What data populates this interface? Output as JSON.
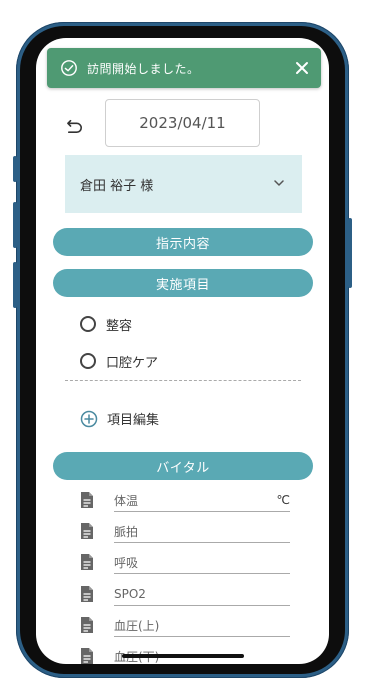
{
  "toast": {
    "message": "訪問開始しました。",
    "color": "#4f9a73"
  },
  "header": {
    "date_value": "2023/04/11"
  },
  "patient": {
    "name": "倉田 裕子 様"
  },
  "sections": {
    "instructions": "指示内容",
    "items": "実施項目",
    "vitals": "バイタル"
  },
  "care_items": [
    {
      "label": "整容",
      "checked": false
    },
    {
      "label": "口腔ケア",
      "checked": false
    }
  ],
  "edit_items_label": "項目編集",
  "vitals": [
    {
      "label": "体温",
      "unit": "℃"
    },
    {
      "label": "脈拍",
      "unit": ""
    },
    {
      "label": "呼吸",
      "unit": ""
    },
    {
      "label": "SPO2",
      "unit": ""
    },
    {
      "label": "血圧(上)",
      "unit": ""
    },
    {
      "label": "血圧(下)",
      "unit": ""
    }
  ],
  "colors": {
    "accent": "#5aa9b4",
    "patient_bg": "#dbeef0",
    "frame": "#2c5f86"
  },
  "icons": {
    "toast": "check-circle-icon",
    "close": "close-icon",
    "back": "undo-arrow-icon",
    "dropdown": "chevron-down-icon",
    "edit": "plus-circle-icon",
    "vital": "document-icon"
  }
}
